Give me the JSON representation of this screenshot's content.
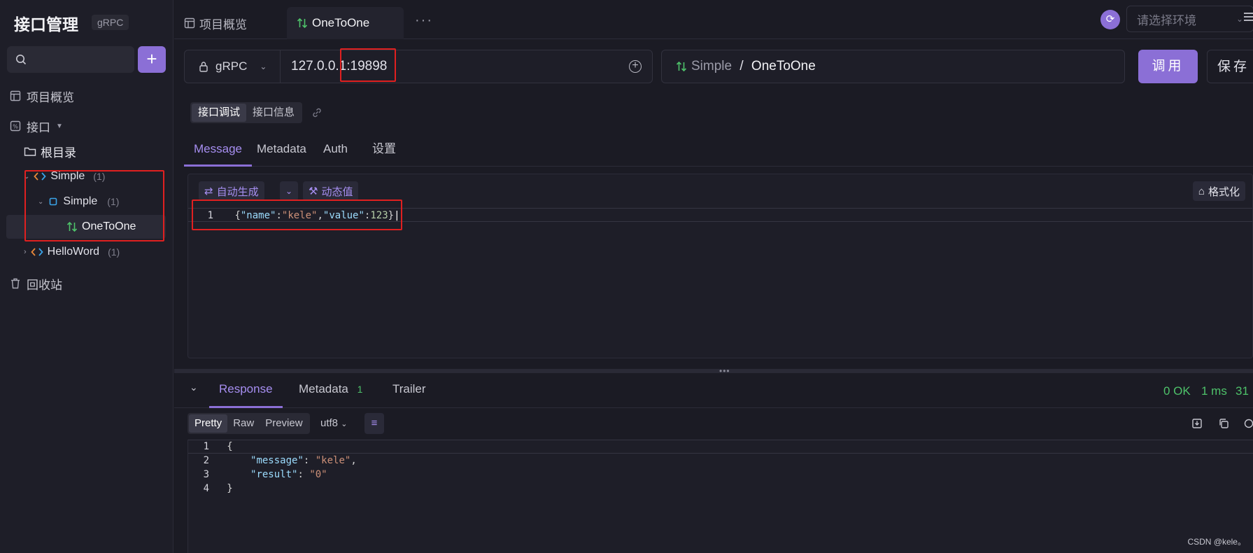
{
  "app": {
    "title": "接口管理",
    "protocol_badge": "gRPC"
  },
  "sidebar": {
    "add_label": "+",
    "overview": "项目概览",
    "interfaces": "接口",
    "root": "根目录",
    "tree": [
      {
        "name": "Simple",
        "count": "(1)"
      },
      {
        "name": "Simple",
        "count": "(1)"
      },
      {
        "name": "OneToOne"
      },
      {
        "name": "HelloWord",
        "count": "(1)"
      }
    ],
    "recycle": "回收站"
  },
  "tabs": {
    "overview": "项目概览",
    "active": "OneToOne",
    "more": "···"
  },
  "env": {
    "placeholder": "请选择环境"
  },
  "request": {
    "protocol": "gRPC",
    "url": "127.0.0.1:19898",
    "service": "Simple",
    "separator": " / ",
    "method": "OneToOne",
    "call_label": "调用",
    "save_label": "保存"
  },
  "mode_tabs": [
    "接口调试",
    "接口信息"
  ],
  "request_tabs": [
    "Message",
    "Metadata",
    "Auth",
    "设置"
  ],
  "editor": {
    "auto_generate": "自动生成",
    "dynamic_value": "动态值",
    "format": "格式化",
    "line_number": "1",
    "tokens": [
      {
        "t": "{",
        "c": "p"
      },
      {
        "t": "\"name\"",
        "c": "k"
      },
      {
        "t": ":",
        "c": "p"
      },
      {
        "t": "\"kele\"",
        "c": "s"
      },
      {
        "t": ",",
        "c": "p"
      },
      {
        "t": "\"value\"",
        "c": "k"
      },
      {
        "t": ":",
        "c": "p"
      },
      {
        "t": "123",
        "c": "n"
      },
      {
        "t": "}",
        "c": "p"
      }
    ]
  },
  "response": {
    "tabs": [
      "Response",
      "Metadata",
      "Trailer"
    ],
    "metadata_count": "1",
    "status": "0 OK",
    "time": "1 ms",
    "size": "31",
    "views": [
      "Pretty",
      "Raw",
      "Preview"
    ],
    "encoding": "utf8",
    "lines": [
      {
        "n": "1",
        "tokens": [
          {
            "t": "{",
            "c": "p"
          }
        ]
      },
      {
        "n": "2",
        "tokens": [
          {
            "t": "    ",
            "c": "p"
          },
          {
            "t": "\"message\"",
            "c": "k"
          },
          {
            "t": ": ",
            "c": "p"
          },
          {
            "t": "\"kele\"",
            "c": "s"
          },
          {
            "t": ",",
            "c": "p"
          }
        ]
      },
      {
        "n": "3",
        "tokens": [
          {
            "t": "    ",
            "c": "p"
          },
          {
            "t": "\"result\"",
            "c": "k"
          },
          {
            "t": ": ",
            "c": "p"
          },
          {
            "t": "\"0\"",
            "c": "s"
          }
        ]
      },
      {
        "n": "4",
        "tokens": [
          {
            "t": "}",
            "c": "p"
          }
        ]
      }
    ]
  },
  "watermark": "CSDN @kele。",
  "colors": {
    "accent": "#8b6fd6",
    "success": "#4ec26a",
    "highlight": "#e02020"
  }
}
